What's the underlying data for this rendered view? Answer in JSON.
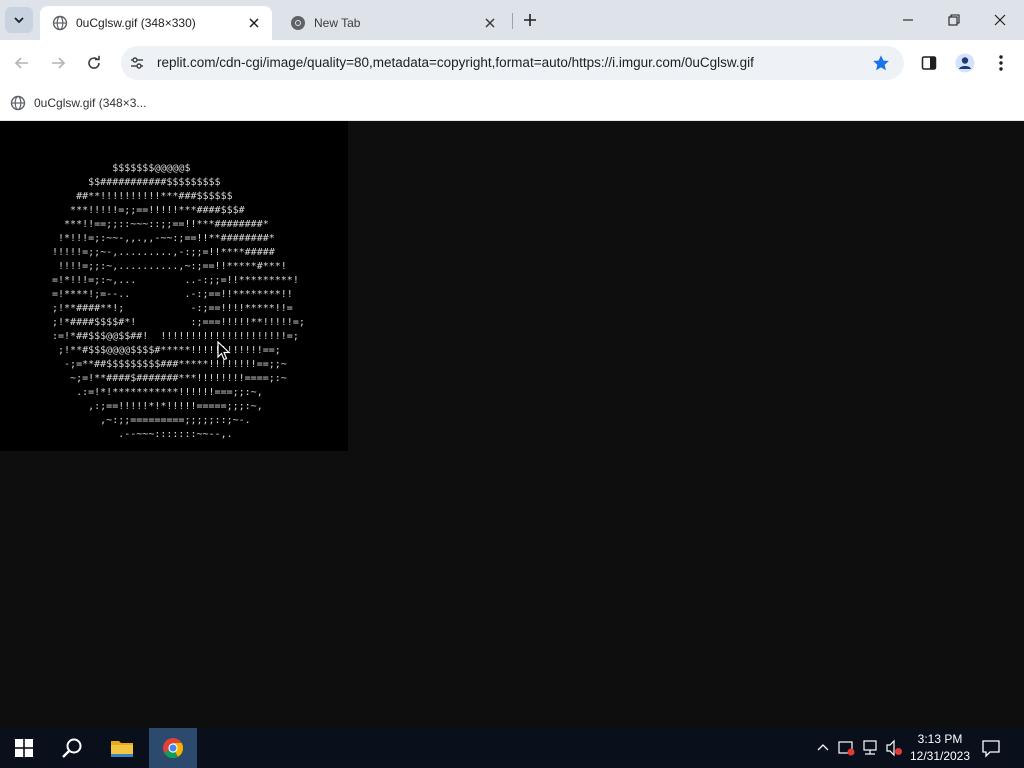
{
  "browser": {
    "tabs": [
      {
        "title": "0uCglsw.gif (348×330)",
        "active": true,
        "favicon": "globe-icon"
      },
      {
        "title": "New Tab",
        "active": false,
        "favicon": "chrome-icon"
      }
    ],
    "address_bar": {
      "url": "replit.com/cdn-cgi/image/quality=80,metadata=copyright,format=auto/https://i.imgur.com/0uCglsw.gif",
      "bookmarked": true
    },
    "bookmarks_bar": [
      {
        "label": "0uCglsw.gif (348×3...",
        "favicon": "globe-icon"
      }
    ]
  },
  "content": {
    "image_name": "0uCglsw.gif",
    "ascii_art": "          $$$$$$$@@@@@$\n      $$###########$$$$$$$$$\n    ##**!!!!!!!!!!***###$$$$$$\n   ***!!!!!=;;==!!!!!***####$$$#\n  ***!!==;;::~~~::;;==!!***########*\n !*!!!=;:~~-,,.,,-~~:;==!!**########*\n!!!!!=;;~-,.........,-:;;=!!****#####\n !!!!=;;:~,..........,~:;==!!*****#***!\n=!*!!!=;:~,...        ..-:;;=!!*********!\n=!****!;=--..         .-:;==!!********!!\n;!**####**!;           -:;==!!!!*****!!=\n;!*####$$$$#*!         :;===!!!!!**!!!!!=;\n:=!*##$$$@@$$##!  !!!!!!!!!!!!!!!!!!!!!=;\n ;!**#$$$@@@@$$$$#*****!!!!!!!!!!!!==;\n  -;=**##$$$$$$$$$###*****!!!!!!!!==;;~\n   ~;=!**####$#######***!!!!!!!!====;:~\n    .:=!*!***********!!!!!!===;;:~,\n      ,:;==!!!!!*!*!!!!!=====;;;:~,\n        ,~:;;=========;;;;;::;~-.\n           .--~~~:::::::~~--,."
  },
  "taskbar": {
    "pinned": [
      "start-icon",
      "search-icon",
      "file-explorer-icon",
      "chrome-icon"
    ],
    "clock": {
      "time": "3:13 PM",
      "date": "12/31/2023"
    }
  },
  "colors": {
    "accent_star": "#1a73e8",
    "content_bg": "#0e0e0e",
    "image_bg": "#000000",
    "ascii_fg": "#d8d8d8",
    "taskbar_bg": "#0a0f1c"
  }
}
